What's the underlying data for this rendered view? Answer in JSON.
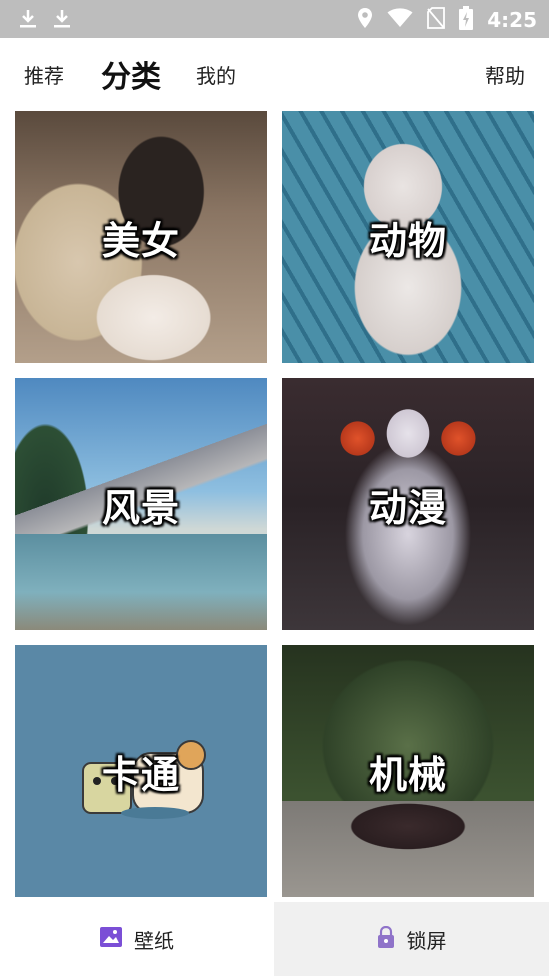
{
  "status_bar": {
    "time": "4:25",
    "icons": [
      "download-icon",
      "download-icon",
      "location-icon",
      "wifi-icon",
      "no-sim-icon",
      "battery-charging-icon"
    ]
  },
  "nav": {
    "tabs": [
      {
        "label": "推荐",
        "active": false
      },
      {
        "label": "分类",
        "active": true
      },
      {
        "label": "我的",
        "active": false
      }
    ],
    "help_label": "帮助"
  },
  "categories": [
    {
      "label": "美女"
    },
    {
      "label": "动物"
    },
    {
      "label": "风景"
    },
    {
      "label": "动漫"
    },
    {
      "label": "卡通"
    },
    {
      "label": "机械"
    }
  ],
  "bottom_bar": {
    "wallpaper_label": "壁纸",
    "lockscreen_label": "锁屏",
    "accent": "#7b4fd6"
  }
}
